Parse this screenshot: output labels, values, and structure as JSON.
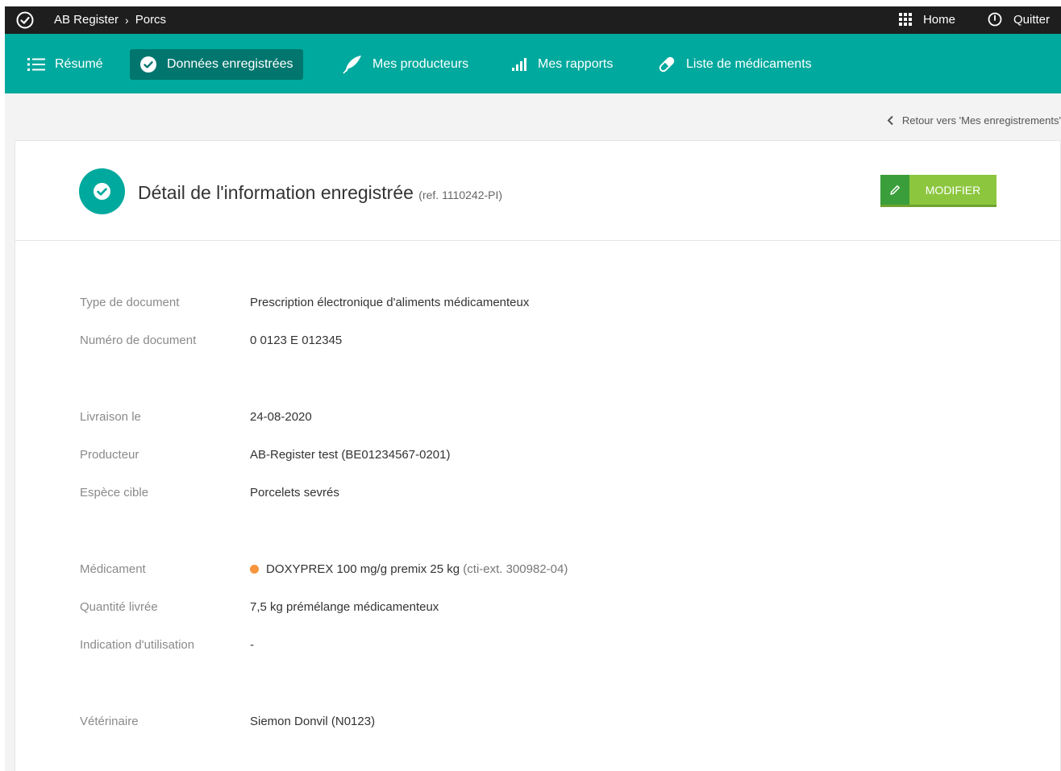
{
  "topbar": {
    "app_name": "AB Register",
    "breadcrumb_sep": "›",
    "section": "Porcs",
    "home_label": "Home",
    "quit_label": "Quitter"
  },
  "nav": {
    "tabs": [
      {
        "label": "Résumé",
        "icon": "list-icon",
        "active": false
      },
      {
        "label": "Données enregistrées",
        "icon": "check-circle-icon",
        "active": true
      },
      {
        "label": "Mes producteurs",
        "icon": "feather-icon",
        "active": false
      },
      {
        "label": "Mes rapports",
        "icon": "bar-chart-icon",
        "active": false
      },
      {
        "label": "Liste de médicaments",
        "icon": "pill-icon",
        "active": false
      }
    ]
  },
  "back_link": "Retour vers 'Mes enregistrements'",
  "detail": {
    "title": "Détail de l'information enregistrée",
    "ref": "(ref. 1110242-PI)",
    "modify_label": "MODIFIER"
  },
  "fields": {
    "doc_type": {
      "label": "Type de document",
      "value": "Prescription électronique d'aliments médicamenteux"
    },
    "doc_number": {
      "label": "Numéro de document",
      "value": "0 0123 E 012345"
    },
    "delivery": {
      "label": "Livraison le",
      "value": "24-08-2020"
    },
    "producer": {
      "label": "Producteur",
      "value": "AB-Register test (BE01234567-0201)"
    },
    "species": {
      "label": "Espèce cible",
      "value": "Porcelets sevrés"
    },
    "medication": {
      "label": "Médicament",
      "value": "DOXYPREX 100 mg/g premix 25 kg",
      "cti": "(cti-ext. 300982-04)",
      "status_color": "#f7943c"
    },
    "quantity": {
      "label": "Quantité livrée",
      "value": "7,5 kg prémélange médicamenteux"
    },
    "indication": {
      "label": "Indication d'utilisation",
      "value": "-"
    },
    "vet": {
      "label": "Vétérinaire",
      "value": "Siemon Donvil (N0123)"
    }
  },
  "colors": {
    "topbar": "#1e1e1e",
    "nav": "#00a99d",
    "nav_active": "#00766e",
    "modify_button": "#8cc63f"
  }
}
